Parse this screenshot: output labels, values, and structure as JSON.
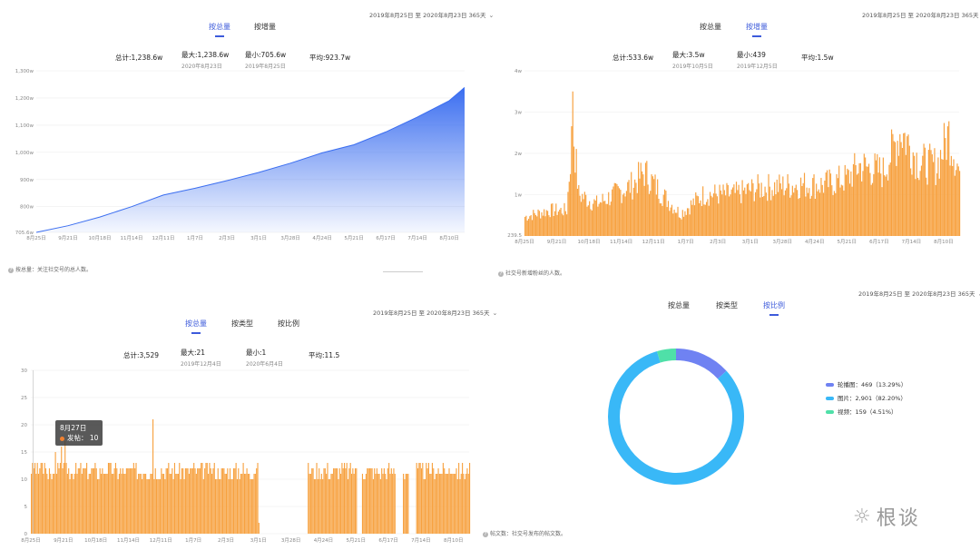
{
  "colors": {
    "accent": "#3d5bdb",
    "blue_area": "#3b6ef0",
    "orange_bar": "#f7a13f",
    "donut_1": "#6f82f2",
    "donut_2": "#39b8f7",
    "donut_3": "#4fe0a8"
  },
  "panel1": {
    "tabs": [
      {
        "label": "按总量",
        "active": true
      },
      {
        "label": "按增量",
        "active": false
      }
    ],
    "date_range": "2019年8月25日 至 2020年8月23日 365天",
    "stats": {
      "total": "总计:1,238.6w",
      "max": "最大:1,238.6w",
      "max_date": "2020年8月23日",
      "min": "最小:705.6w",
      "min_date": "2019年8月25日",
      "avg": "平均:923.7w"
    },
    "footnote": "按总量：关注社交号的总人数。",
    "chart_data": {
      "type": "area",
      "yticks": [
        "705.6w",
        "800w",
        "900w",
        "1,000w",
        "1,100w",
        "1,200w",
        "1,300w"
      ],
      "ytick_values": [
        705.6,
        800,
        900,
        1000,
        1100,
        1200,
        1300
      ],
      "xticks": [
        "8月25日",
        "9月21日",
        "10月18日",
        "11月14日",
        "12月11日",
        "1月7日",
        "2月3日",
        "3月1日",
        "3月28日",
        "4月24日",
        "5月21日",
        "6月17日",
        "7月14日",
        "8月10日"
      ],
      "ylim": [
        705.6,
        1300
      ],
      "x": [
        0,
        27,
        54,
        81,
        108,
        135,
        162,
        189,
        216,
        243,
        270,
        297,
        324,
        351,
        364
      ],
      "values": [
        705.6,
        730,
        762,
        800,
        843,
        868,
        896,
        926,
        960,
        998,
        1028,
        1075,
        1130,
        1190,
        1238.6
      ]
    }
  },
  "panel2": {
    "tabs": [
      {
        "label": "按总量",
        "active": false
      },
      {
        "label": "按增量",
        "active": true
      }
    ],
    "date_range": "2019年8月25日 至 2020年8月23日 365天",
    "stats": {
      "total": "总计:533.6w",
      "max": "最大:3.5w",
      "max_date": "2019年10月5日",
      "min": "最小:439",
      "min_date": "2019年12月5日",
      "avg": "平均:1.5w"
    },
    "footnote": "社交号新增粉丝的人数。",
    "chart_data": {
      "type": "bar",
      "yticks": [
        "239.5",
        "1w",
        "2w",
        "3w",
        "4w"
      ],
      "ytick_values": [
        0.02,
        1,
        2,
        3,
        4
      ],
      "xticks": [
        "8月25日",
        "9月21日",
        "10月18日",
        "11月14日",
        "12月11日",
        "1月7日",
        "2月3日",
        "3月1日",
        "3月28日",
        "4月24日",
        "5月21日",
        "6月17日",
        "7月14日",
        "8月10日"
      ],
      "ylim": [
        0,
        4
      ],
      "envelope": [
        [
          0,
          0.6
        ],
        [
          20,
          0.8
        ],
        [
          35,
          0.8
        ],
        [
          40,
          3.5
        ],
        [
          45,
          1.3
        ],
        [
          60,
          1.0
        ],
        [
          75,
          1.3
        ],
        [
          90,
          1.6
        ],
        [
          100,
          2.0
        ],
        [
          115,
          1.3
        ],
        [
          130,
          0.7
        ],
        [
          150,
          1.3
        ],
        [
          175,
          1.3
        ],
        [
          195,
          1.5
        ],
        [
          230,
          1.6
        ],
        [
          250,
          1.6
        ],
        [
          270,
          1.8
        ],
        [
          280,
          2.2
        ],
        [
          300,
          2.0
        ],
        [
          315,
          3.3
        ],
        [
          330,
          2.3
        ],
        [
          345,
          2.2
        ],
        [
          355,
          3.2
        ],
        [
          364,
          2.0
        ]
      ]
    }
  },
  "panel3": {
    "tabs": [
      {
        "label": "按总量",
        "active": true
      },
      {
        "label": "按类型",
        "active": false
      },
      {
        "label": "按比例",
        "active": false
      }
    ],
    "date_range": "2019年8月25日 至 2020年8月23日 365天",
    "stats": {
      "total": "总计:3,529",
      "max": "最大:21",
      "max_date": "2019年12月4日",
      "min": "最小:1",
      "min_date": "2020年6月4日",
      "avg": "平均:11.5"
    },
    "tooltip": {
      "date": "8月27日",
      "label": "发帖",
      "value": "10"
    },
    "footnote": "帖文数：社交号发布的帖文数。",
    "chart_data": {
      "type": "bar",
      "yticks": [
        "0",
        "5",
        "10",
        "15",
        "20",
        "25",
        "30"
      ],
      "ytick_values": [
        0,
        5,
        10,
        15,
        20,
        25,
        30
      ],
      "xticks": [
        "8月25日",
        "9月21日",
        "10月18日",
        "11月14日",
        "12月11日",
        "1月7日",
        "2月3日",
        "3月1日",
        "3月28日",
        "4月24日",
        "5月21日",
        "6月17日",
        "7月14日",
        "8月10日"
      ],
      "ylim": [
        0,
        30
      ],
      "gaps": [
        [
          190,
          229
        ],
        [
          271,
          274
        ],
        [
          303,
          308
        ],
        [
          314,
          319
        ]
      ],
      "max_bar": {
        "day": 101,
        "value": 21
      }
    }
  },
  "panel4": {
    "tabs": [
      {
        "label": "按总量",
        "active": false
      },
      {
        "label": "按类型",
        "active": false
      },
      {
        "label": "按比例",
        "active": true
      }
    ],
    "date_range": "2019年8月25日 至 2020年8月23日 365天",
    "chart_data": {
      "type": "pie",
      "slices": [
        {
          "name": "轮播图",
          "value": 469,
          "pct": "13.29%",
          "label": "轮播图：469（13.29%）"
        },
        {
          "name": "图片",
          "value": 2901,
          "pct": "82.20%",
          "label": "图片：2,901（82.20%）"
        },
        {
          "name": "视频",
          "value": 159,
          "pct": "4.51%",
          "label": "视频：159（4.51%）"
        }
      ]
    }
  },
  "logo": {
    "text": "根谈"
  }
}
